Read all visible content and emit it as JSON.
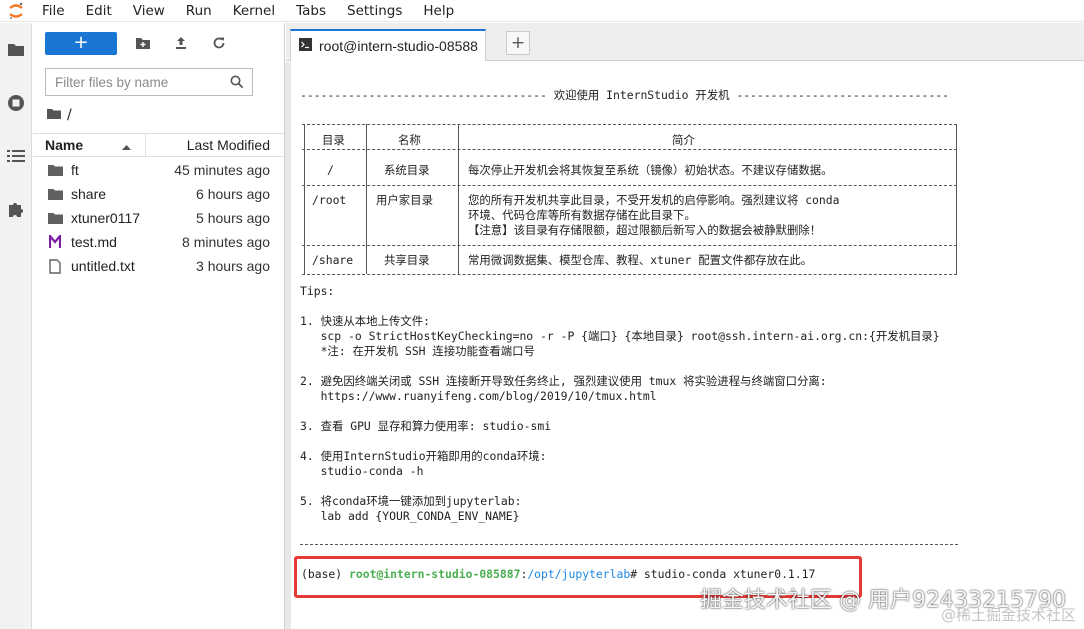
{
  "menubar": {
    "items": [
      "File",
      "Edit",
      "View",
      "Run",
      "Kernel",
      "Tabs",
      "Settings",
      "Help"
    ]
  },
  "filebrowser": {
    "new_label": "+",
    "filter_placeholder": "Filter files by name",
    "breadcrumb": "/",
    "col_name": "Name",
    "col_modified": "Last Modified",
    "files": [
      {
        "name": "ft",
        "type": "folder",
        "modified": "45 minutes ago"
      },
      {
        "name": "share",
        "type": "folder",
        "modified": "6 hours ago"
      },
      {
        "name": "xtuner0117",
        "type": "folder",
        "modified": "5 hours ago"
      },
      {
        "name": "test.md",
        "type": "markdown",
        "modified": "8 minutes ago"
      },
      {
        "name": "untitled.txt",
        "type": "text",
        "modified": "3 hours ago"
      }
    ]
  },
  "tabs": [
    {
      "label": "root@intern-studio-08588"
    }
  ],
  "terminal": {
    "banner": "------------------------------------ 欢迎使用 InternStudio 开发机 -------------------------------",
    "table_header": [
      "目录",
      "名称",
      "简介"
    ],
    "rows": [
      {
        "dir": "/",
        "name": "系统目录",
        "desc": [
          "每次停止开发机会将其恢复至系统（镜像）初始状态。不建议存储数据。"
        ]
      },
      {
        "dir": "/root",
        "name": "用户家目录",
        "desc": [
          "您的所有开发机共享此目录，不受开发机的启停影响。强烈建议将 conda",
          "环境、代码仓库等所有数据存储在此目录下。",
          "【注意】该目录有存储限额，超过限额后新写入的数据会被静默删除！"
        ]
      },
      {
        "dir": "/share",
        "name": "共享目录",
        "desc": [
          "常用微调数据集、模型仓库、教程、xtuner 配置文件都存放在此。"
        ]
      }
    ],
    "tips_title": "Tips:",
    "tips": [
      [
        "1. 快速从本地上传文件:",
        "   scp -o StrictHostKeyChecking=no -r -P {端口} {本地目录} root@ssh.intern-ai.org.cn:{开发机目录}",
        "   *注: 在开发机 SSH 连接功能查看端口号"
      ],
      [
        "2. 避免因终端关闭或 SSH 连接断开导致任务终止, 强烈建议使用 tmux 将实验进程与终端窗口分离:",
        "   https://www.ruanyifeng.com/blog/2019/10/tmux.html"
      ],
      [
        "3. 查看 GPU 显存和算力使用率: studio-smi"
      ],
      [
        "4. 使用InternStudio开箱即用的conda环境:",
        "   studio-conda -h"
      ],
      [
        "5. 将conda环境一键添加到jupyterlab:",
        "   lab add {YOUR_CONDA_ENV_NAME}"
      ]
    ],
    "prompt_env": "(base) ",
    "prompt_user": "root@intern-studio-085887",
    "prompt_colon": ":",
    "prompt_path": "/opt/jupyterlab",
    "prompt_hash": "# ",
    "prompt_cmd": "studio-conda xtuner0.1.17"
  },
  "watermark": {
    "main": "掘金技术社区 @ 用户92433215790",
    "sub": "@稀土掘金技术社区"
  },
  "colors": {
    "accent": "#1976d2",
    "prompt_user": "#4caf50",
    "prompt_path": "#1e88e5",
    "highlight_box": "#e53935"
  }
}
